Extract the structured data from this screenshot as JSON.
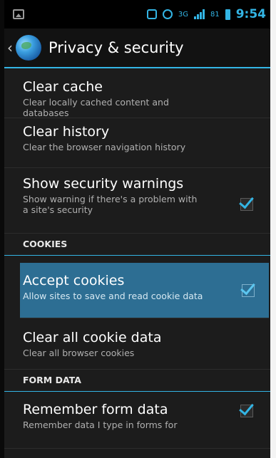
{
  "status_bar": {
    "signal_label": "3G",
    "battery_level": "81",
    "time": "9:54"
  },
  "action_bar": {
    "title": "Privacy & security",
    "up_icon": "chevron-left-icon",
    "logo_icon": "browser-globe-icon"
  },
  "preferences": [
    {
      "title": "Clear cache",
      "summary": "Clear locally cached content and databases"
    },
    {
      "title": "Clear history",
      "summary": "Clear the browser navigation history"
    },
    {
      "title": "Show security warnings",
      "summary": "Show warning if there's a problem with a site's security",
      "checked": true
    }
  ],
  "cookies_section": {
    "header": "COOKIES",
    "items": [
      {
        "title": "Accept cookies",
        "summary": "Allow sites to save and read cookie data",
        "checked": true,
        "selected": true
      },
      {
        "title": "Clear all cookie data",
        "summary": "Clear all browser cookies"
      }
    ]
  },
  "form_section": {
    "header": "FORM DATA",
    "items": [
      {
        "title": "Remember form data",
        "summary": "Remember data I type in forms for",
        "checked": true
      }
    ]
  },
  "colors": {
    "accent": "#33b5e5",
    "selected_row": "#2d6e93",
    "background": "#1c1c1c"
  }
}
